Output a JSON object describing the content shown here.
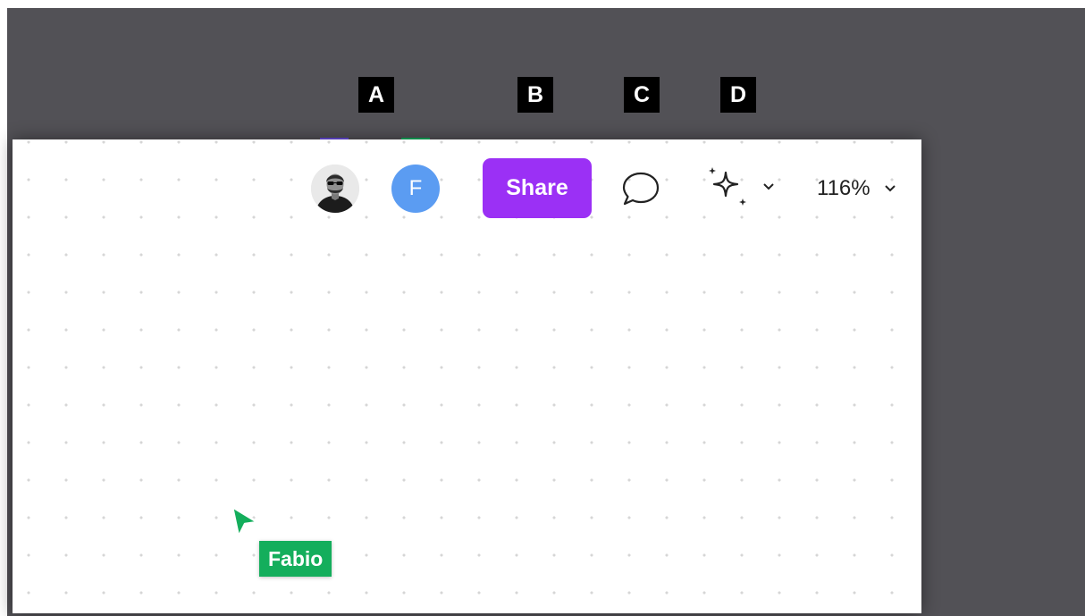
{
  "callouts": {
    "a": "A",
    "b": "B",
    "c": "C",
    "d": "D"
  },
  "toolbar": {
    "avatars": [
      {
        "kind": "photo",
        "presence_color": "#6a4ee0"
      },
      {
        "initial": "F",
        "color": "#5b9cf2",
        "presence_color": "#14ae5c"
      }
    ],
    "share_label": "Share",
    "share_color": "#9b30f5",
    "comment_icon": "speech-bubble-icon",
    "ai_icon": "sparkle-icon",
    "zoom_label": "116%"
  },
  "canvas": {
    "grid": "dotted",
    "collaborator_cursor": {
      "name": "Fabio",
      "color": "#14ae5c"
    }
  }
}
